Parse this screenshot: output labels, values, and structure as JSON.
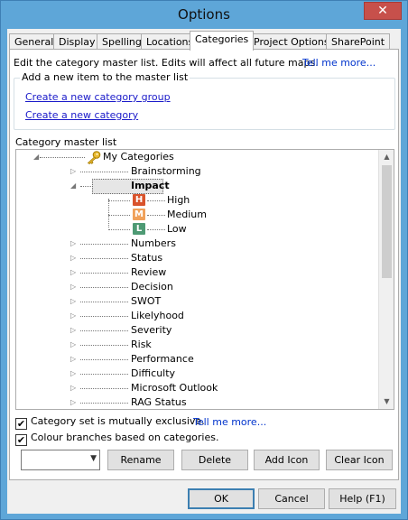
{
  "window": {
    "title": "Options",
    "close_glyph": "✕"
  },
  "tabs": [
    {
      "label": "General"
    },
    {
      "label": "Display"
    },
    {
      "label": "Spelling"
    },
    {
      "label": "Locations"
    },
    {
      "label": "Categories"
    },
    {
      "label": "Project Options"
    },
    {
      "label": "SharePoint"
    }
  ],
  "active_tab": "Categories",
  "intro": {
    "text": "Edit the category master list.  Edits will affect all future maps.",
    "tell_more": "Tell me more..."
  },
  "add_group": {
    "label": "Add a new item to the master list",
    "create_group_link": "Create a new category group",
    "create_category_link": "Create a new category"
  },
  "master_list": {
    "label": "Category master list",
    "root": "My Categories",
    "items": [
      {
        "label": "Brainstorming",
        "expanded": false
      },
      {
        "label": "Impact",
        "expanded": true,
        "selected": true,
        "children": [
          {
            "label": "High",
            "icon_letter": "H",
            "icon_color": "#d9532c"
          },
          {
            "label": "Medium",
            "icon_letter": "M",
            "icon_color": "#f0a15a"
          },
          {
            "label": "Low",
            "icon_letter": "L",
            "icon_color": "#4e9a74"
          }
        ]
      },
      {
        "label": "Numbers",
        "expanded": false
      },
      {
        "label": "Status",
        "expanded": false
      },
      {
        "label": "Review",
        "expanded": false
      },
      {
        "label": "Decision",
        "expanded": false
      },
      {
        "label": "SWOT",
        "expanded": false
      },
      {
        "label": "Likelyhood",
        "expanded": false
      },
      {
        "label": "Severity",
        "expanded": false
      },
      {
        "label": "Risk",
        "expanded": false
      },
      {
        "label": "Performance",
        "expanded": false
      },
      {
        "label": "Difficulty",
        "expanded": false
      },
      {
        "label": "Microsoft Outlook",
        "expanded": false
      },
      {
        "label": "RAG Status",
        "expanded": false
      }
    ]
  },
  "options": {
    "mutually_exclusive": {
      "label": "Category set is mutually exclusive.",
      "checked": true,
      "tell_more": "Tell me more..."
    },
    "colour_branches": {
      "label": "Colour branches based on categories.",
      "checked": true
    }
  },
  "actions": {
    "combo_value": "",
    "rename": "Rename",
    "delete": "Delete",
    "add_icon": "Add Icon",
    "clear_icon": "Clear Icon"
  },
  "footer": {
    "ok": "OK",
    "cancel": "Cancel",
    "help": "Help (F1)"
  },
  "icons": {
    "root_icon": "key-icon",
    "expander_collapsed": "▷",
    "expander_expanded": "◢",
    "checkmark": "✔"
  },
  "colors": {
    "titlebar": "#5ea6d8",
    "close_button": "#c7504b",
    "link": "#1a1ac9",
    "selection": "#e6e6e6"
  }
}
